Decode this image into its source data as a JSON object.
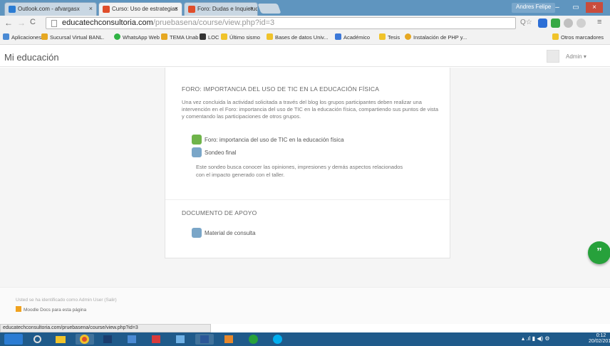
{
  "browser": {
    "tabs": [
      {
        "label": "Outlook.com - afvargasx",
        "color": "#2b7cd3"
      },
      {
        "label": "Curso: Uso de estrategias",
        "color": "#e04e2b",
        "active": true
      },
      {
        "label": "Foro: Dudas e Inquietudes",
        "color": "#e04e2b"
      }
    ],
    "user_button": "Andres Felipe",
    "url_host": "educatechconsultoria.com",
    "url_path": "/pruebasena/course/view.php?id=3",
    "bookmarks": [
      {
        "label": "Aplicaciones",
        "color": "#4a8ad4"
      },
      {
        "label": "Sucursal Virtual BANL.",
        "color": "#e6a822"
      },
      {
        "label": "WhatsApp Web",
        "color": "#2fb344"
      },
      {
        "label": "TEMA Unab",
        "color": "#e6a822"
      },
      {
        "label": "LOC",
        "color": "#333333"
      },
      {
        "label": "Último sismo",
        "color": "#f0c32a"
      },
      {
        "label": "Bases de datos Univ...",
        "color": "#f0c32a"
      },
      {
        "label": "Académico",
        "color": "#3c78d8"
      },
      {
        "label": "Tesis",
        "color": "#f0c32a"
      },
      {
        "label": "Instalación de PHP y...",
        "color": "#e6a822"
      },
      {
        "label": "Otros marcadores",
        "color": "#f0c32a"
      }
    ]
  },
  "site": {
    "name": "Mi educación",
    "admin": "Admin"
  },
  "sections": [
    {
      "title": "FORO: IMPORTANCIA DEL USO DE TIC EN LA EDUCACIÓN FÍSICA",
      "summary": "Una vez concluida la actividad solicitada a través del blog los grupos participantes deben realizar una intervención en el Foro: importancia del uso de TIC en la educación física, compartiendo sus puntos de vista y comentando las participaciones de otros grupos.",
      "activities": [
        {
          "label": "Foro: importancia del uso de TIC en la educación física",
          "icon": "forum-icon"
        },
        {
          "label": "Sondeo final",
          "icon": "survey-icon"
        }
      ],
      "survey_desc": "Este sondeo busca conocer las opiniones, impresiones y demás aspectos relacionados con el impacto generado con el taller."
    },
    {
      "title": "DOCUMENTO DE APOYO",
      "activities": [
        {
          "label": "Material de consulta",
          "icon": "resource-icon"
        }
      ]
    }
  ],
  "footer": {
    "logged_in": "Usted se ha identificado como Admin User (Salir)",
    "moodle_docs": "Moodle Docs para esta página"
  },
  "status_url": "educatechconsultoria.com/pruebasena/course/view.php?id=3",
  "clock": {
    "time": "0:12",
    "date": "20/02/2016"
  }
}
